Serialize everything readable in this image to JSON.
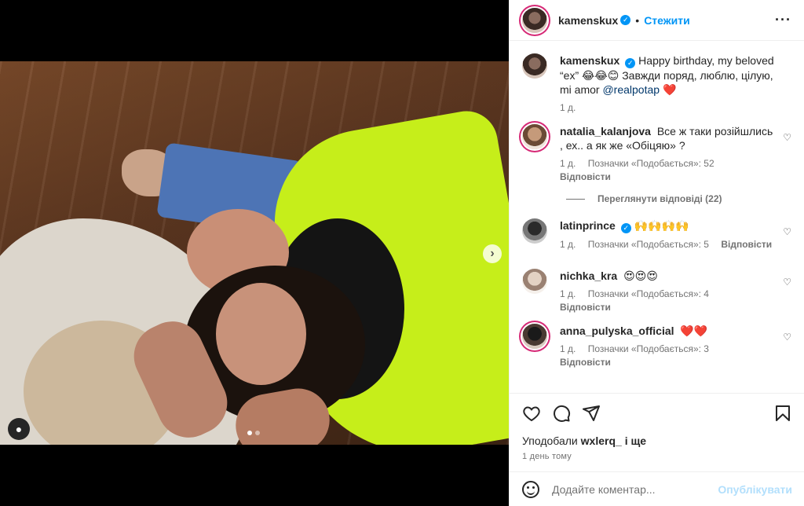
{
  "post": {
    "author": "kamenskux",
    "follow_label": "Стежити",
    "more_icon": "more-horizontal-icon",
    "caption": {
      "text": "Happy birthday, my beloved “ex” 😂😂😊 Завжди поряд, люблю, цілую, mi amor",
      "mention": "@realpotap",
      "end_emoji": "❤️",
      "time": "1 д."
    },
    "media": {
      "carousel_count": 2,
      "active_index": 0
    }
  },
  "comments": [
    {
      "user": "natalia_kalanjova",
      "text": "Все ж таки розійшлись , ех.. а як же «Обіцяю» ?",
      "time": "1 д.",
      "likes": "Позначки «Подобається»: 52",
      "reply": "Відповісти",
      "view_replies": "Переглянути відповіді (22)"
    },
    {
      "user": "latinprince",
      "text": "🙌🙌🙌🙌",
      "time": "1 д.",
      "likes": "Позначки «Подобається»: 5",
      "reply": "Відповісти"
    },
    {
      "user": "nichka_kra",
      "text": "😍😍😍",
      "time": "1 д.",
      "likes": "Позначки «Подобається»: 4",
      "reply": "Відповісти"
    },
    {
      "user": "anna_pulyska_official",
      "text": "❤️❤️",
      "time": "1 д.",
      "likes": "Позначки «Подобається»: 3",
      "reply": "Відповісти"
    }
  ],
  "actions": {
    "liked_by_prefix": "Уподобали",
    "liked_by_user": "wxlerq_",
    "liked_by_suffix": "і ще",
    "post_time": "1 день тому"
  },
  "add_comment": {
    "placeholder": "Додайте коментар...",
    "post_label": "Опублікувати"
  },
  "colors": {
    "accent": "#0095f6",
    "post_disabled": "#b2dffc",
    "hoodie": "#c6ee1a"
  }
}
